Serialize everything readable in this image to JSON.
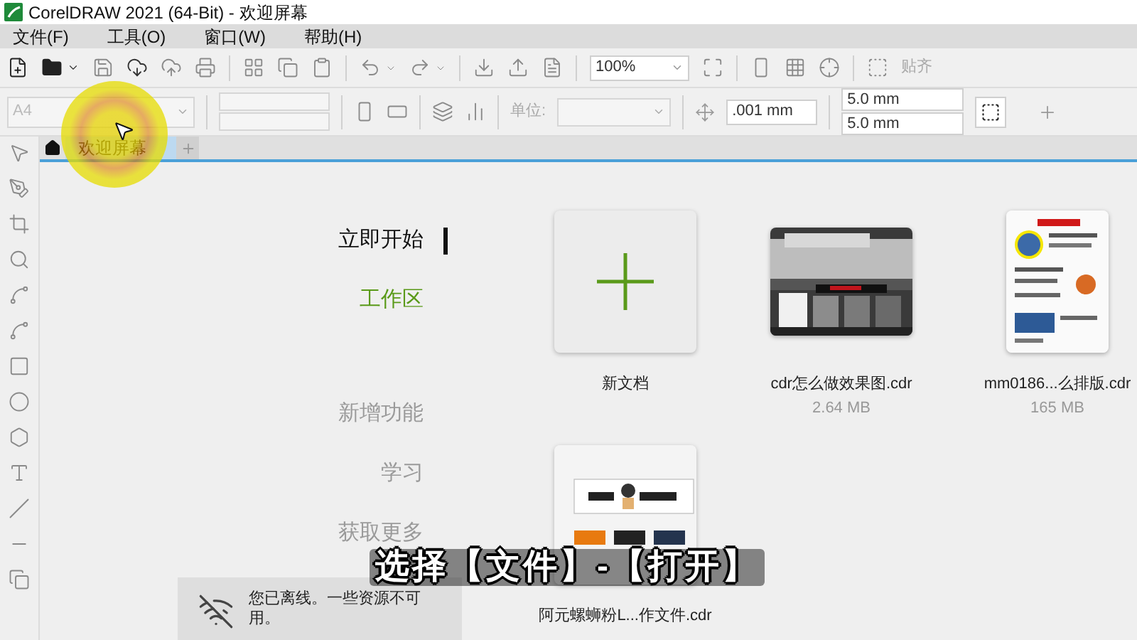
{
  "window": {
    "title": "CorelDRAW 2021 (64-Bit) - 欢迎屏幕"
  },
  "menu": [
    "文件(F)",
    "工具(O)",
    "窗口(W)",
    "帮助(H)"
  ],
  "toolbar": {
    "zoom": "100%",
    "snap": "贴齐"
  },
  "property_bar": {
    "page_size": "A4",
    "units_label": "单位:",
    "nudge": ".001 mm",
    "dup_x": "5.0 mm",
    "dup_y": "5.0 mm"
  },
  "tabs": [
    {
      "label": "欢迎屏幕",
      "selected": true
    }
  ],
  "nav": [
    {
      "label": "立即开始",
      "selected": true,
      "hovered": false
    },
    {
      "label": "工作区",
      "selected": false,
      "hovered": true
    },
    {
      "label": "新增功能",
      "selected": false,
      "hovered": false
    },
    {
      "label": "学习",
      "selected": false,
      "hovered": false
    },
    {
      "label": "获取更多",
      "selected": false,
      "hovered": false
    }
  ],
  "files": [
    {
      "kind": "new",
      "name": "新文档"
    },
    {
      "name": "cdr怎么做效果图.cdr",
      "size": "2.64 MB"
    },
    {
      "kind": "poster",
      "name": "mm0186...么排版.cdr",
      "size": "165 MB"
    },
    {
      "kind": "logo",
      "name": "阿元螺蛳粉L...作文件.cdr"
    }
  ],
  "notification": {
    "text": "您已离线。一些资源不可用。"
  },
  "caption": "选择【文件】-【打开】"
}
